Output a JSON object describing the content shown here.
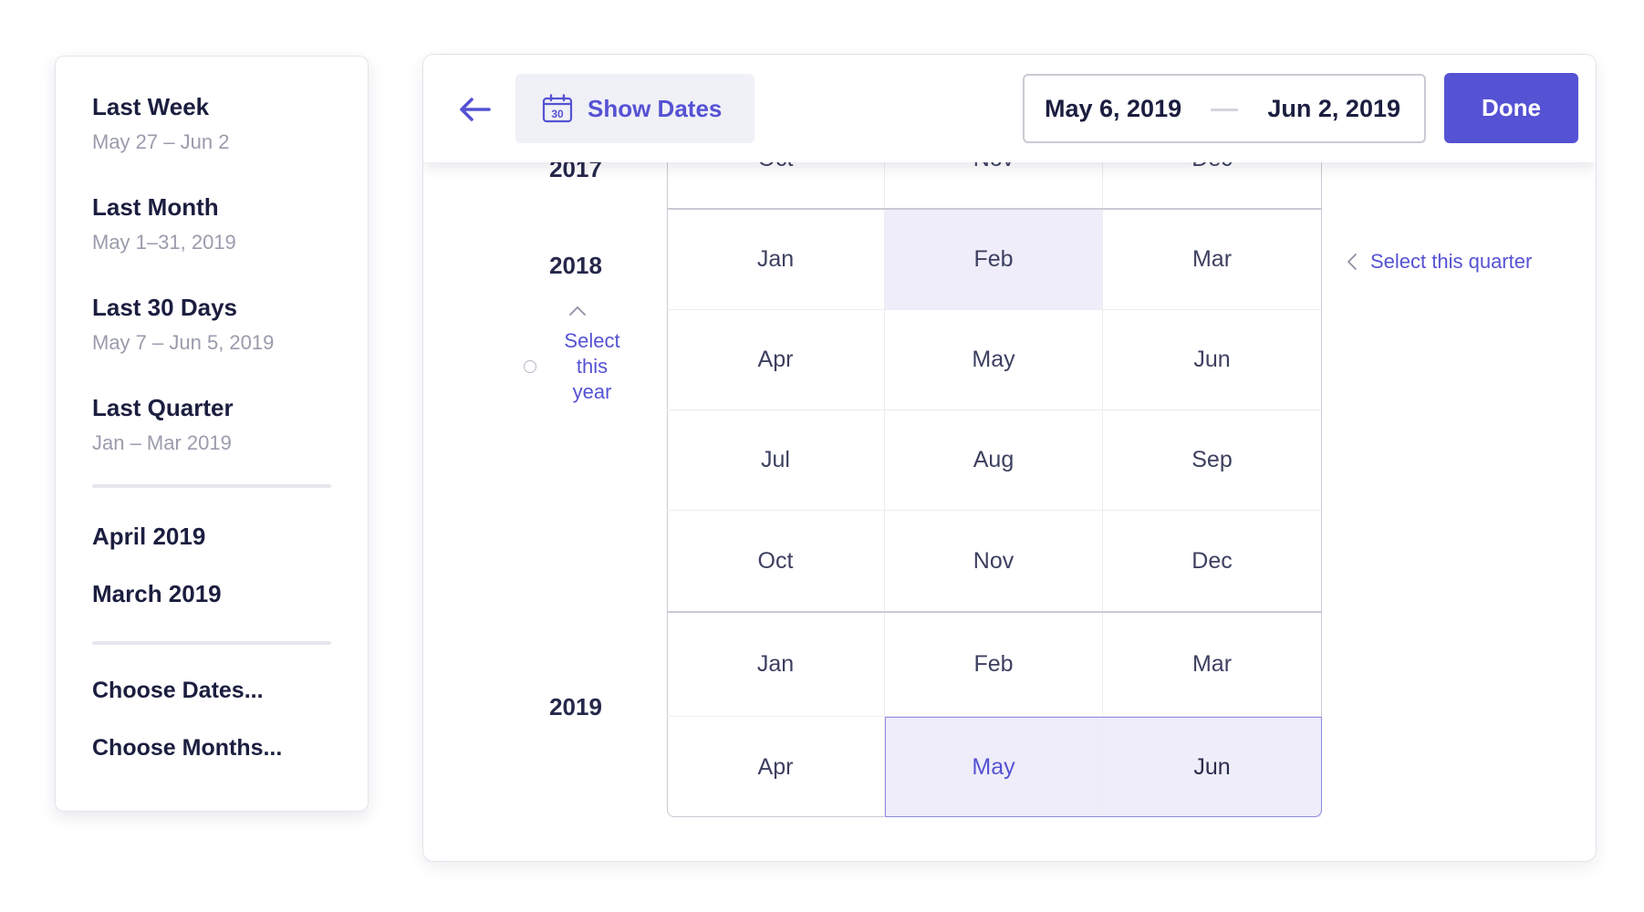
{
  "presets": {
    "items": [
      {
        "title": "Last Week",
        "subtitle": "May 27 – Jun 2"
      },
      {
        "title": "Last Month",
        "subtitle": "May 1–31, 2019"
      },
      {
        "title": "Last 30 Days",
        "subtitle": "May 7 – Jun 5, 2019"
      },
      {
        "title": "Last Quarter",
        "subtitle": "Jan – Mar 2019"
      }
    ],
    "months": [
      "April 2019",
      "March 2019"
    ],
    "actions": [
      "Choose Dates...",
      "Choose Months..."
    ]
  },
  "header": {
    "show_dates_label": "Show Dates",
    "calendar_day": "30",
    "range_start": "May 6, 2019",
    "range_end": "Jun 2, 2019",
    "done_label": "Done"
  },
  "grid": {
    "years": [
      "2017",
      "2018",
      "2019"
    ],
    "select_year": [
      "Select",
      "this",
      "year"
    ],
    "select_quarter": "Select this quarter",
    "rows": [
      [
        "Oct",
        "Nov",
        "Dec"
      ],
      [
        "Jan",
        "Feb",
        "Mar"
      ],
      [
        "Apr",
        "May",
        "Jun"
      ],
      [
        "Jul",
        "Aug",
        "Sep"
      ],
      [
        "Oct",
        "Nov",
        "Dec"
      ],
      [
        "Jan",
        "Feb",
        "Mar"
      ],
      [
        "Apr",
        "May",
        "Jun"
      ]
    ]
  },
  "colors": {
    "accent": "#5552d4",
    "highlight": "#eeedf9",
    "text": "#1b1e3f",
    "muted": "#9a9cac"
  }
}
